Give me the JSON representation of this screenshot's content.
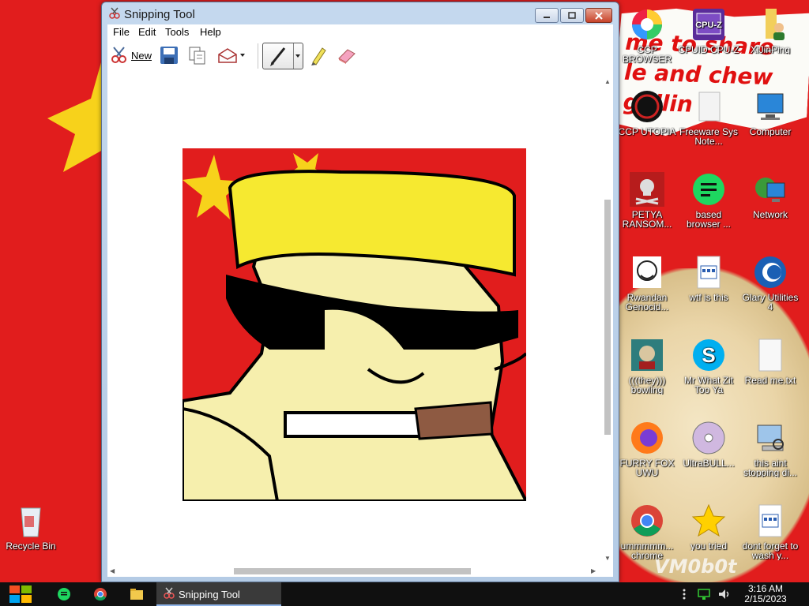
{
  "window": {
    "title": "Snipping Tool",
    "menu": [
      "File",
      "Edit",
      "Tools",
      "Help"
    ],
    "toolbar": {
      "new_label": "New"
    }
  },
  "desktop": {
    "banner_lines": [
      "me to share",
      "le and chew",
      "g illin"
    ],
    "watermark": "VM0b0t",
    "icons": [
      {
        "label": "CCP BROWSER",
        "icon": "browser-icon"
      },
      {
        "label": "CPUID CPU-Z",
        "icon": "cpu-z-icon"
      },
      {
        "label": "XiJinPing",
        "icon": "folder-person-icon"
      },
      {
        "label": "CCP UTOPIA",
        "icon": "utopia-icon"
      },
      {
        "label": "Freeware Sys Note...",
        "icon": "document-icon"
      },
      {
        "label": "Computer",
        "icon": "computer-icon"
      },
      {
        "label": "PETYA RANSOM...",
        "icon": "skull-icon"
      },
      {
        "label": "based browser ...",
        "icon": "chat-icon"
      },
      {
        "label": "Network",
        "icon": "network-icon"
      },
      {
        "label": "Rwandan Genocid...",
        "icon": "meme-face-icon"
      },
      {
        "label": "wtf is this",
        "icon": "html-file-icon"
      },
      {
        "label": "Glary Utilities 4",
        "icon": "glary-icon"
      },
      {
        "label": "(((they))) bowling",
        "icon": "game-icon"
      },
      {
        "label": "Mr What Zit Too Ya",
        "icon": "skype-icon"
      },
      {
        "label": "Read me.txt",
        "icon": "text-file-icon"
      },
      {
        "label": "FURRY FOX UWU",
        "icon": "firefox-icon"
      },
      {
        "label": "UltraBULL...",
        "icon": "disc-icon"
      },
      {
        "label": "this aint stopping di...",
        "icon": "computer-search-icon"
      },
      {
        "label": "ummmmm... chrome",
        "icon": "chrome-icon"
      },
      {
        "label": "you tried",
        "icon": "star-icon"
      },
      {
        "label": "dont forget to wash y...",
        "icon": "html-file-icon"
      },
      {
        "label": "Recycle Bin",
        "icon": "recycle-bin-icon"
      }
    ]
  },
  "taskbar": {
    "active_task": "Snipping Tool",
    "time": "3:16 AM",
    "date": "2/15/2023"
  }
}
